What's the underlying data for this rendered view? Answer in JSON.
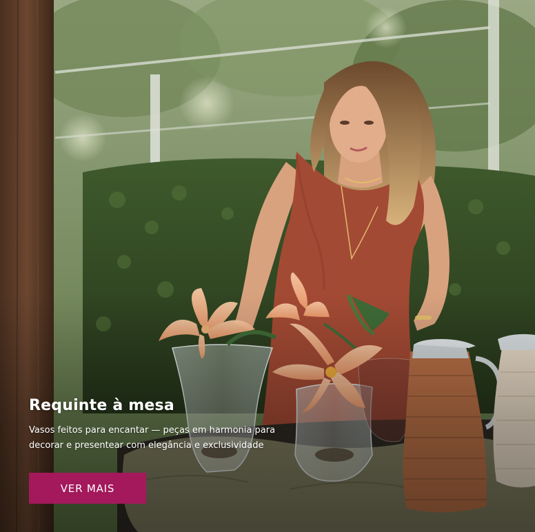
{
  "banner": {
    "title": "Requinte à mesa",
    "description": "Vasos feitos para encantar — peças em harmonia para decorar e presentear com elegância e exclusividade",
    "cta_label": "VER MAIS",
    "image_alt": "woman-arranging-lilies-in-glass-vases",
    "colors": {
      "cta_background": "#a3195b",
      "text": "#ffffff"
    }
  }
}
